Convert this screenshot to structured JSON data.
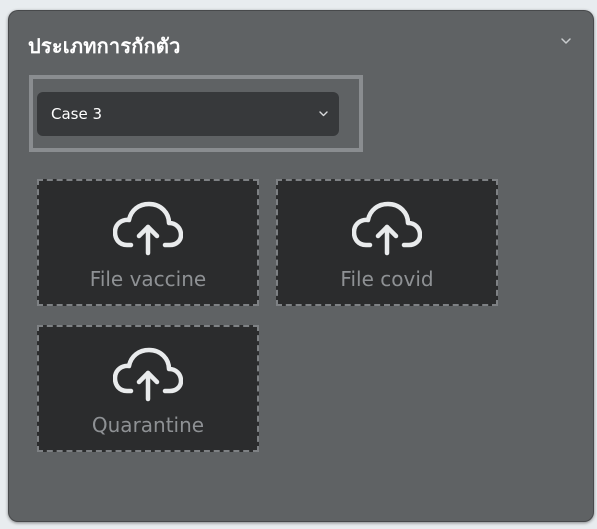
{
  "panel": {
    "title": "ประเภทการกักตัว",
    "collapse_icon": "chevron-down-icon"
  },
  "case_select": {
    "selected": "Case 3",
    "icon": "chevron-down-icon"
  },
  "upload_tiles": [
    {
      "label": "File vaccine",
      "icon": "cloud-upload-icon"
    },
    {
      "label": "File covid",
      "icon": "cloud-upload-icon"
    },
    {
      "label": "Quarantine",
      "icon": "cloud-upload-icon"
    }
  ],
  "colors": {
    "panel_bg": "#5f6264",
    "tile_bg": "#2b2c2d",
    "select_bg": "#37393b",
    "muted_text": "#8e9194"
  }
}
